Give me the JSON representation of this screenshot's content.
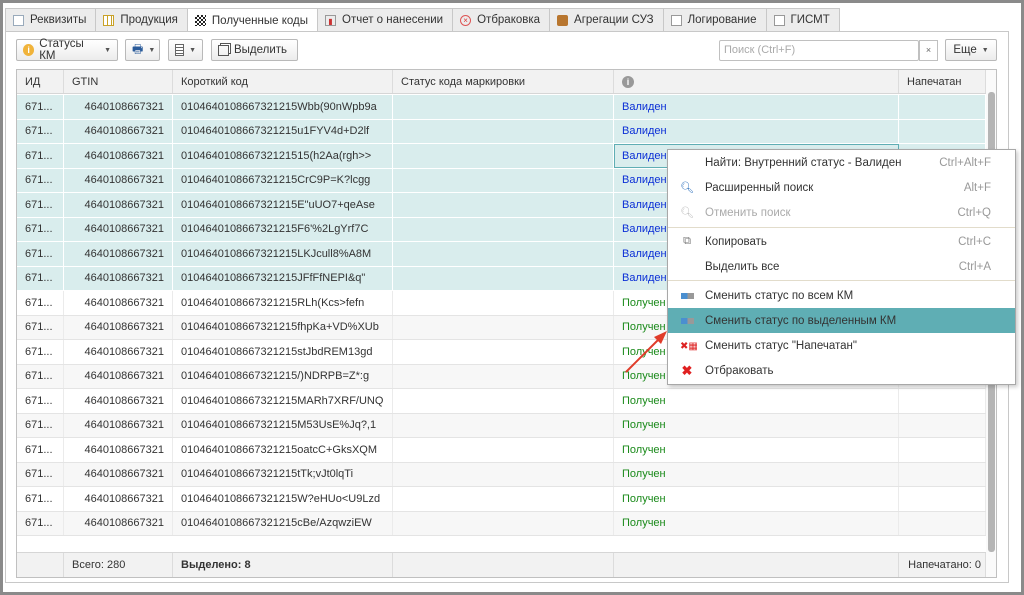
{
  "tabs": [
    {
      "label": "Реквизиты",
      "icon": "document-icon"
    },
    {
      "label": "Продукция",
      "icon": "table-icon"
    },
    {
      "label": "Полученные коды",
      "icon": "qr-code-icon",
      "active": true
    },
    {
      "label": "Отчет о нанесении",
      "icon": "report-icon"
    },
    {
      "label": "Отбраковка",
      "icon": "reject-icon"
    },
    {
      "label": "Агрегации СУЗ",
      "icon": "box-icon"
    },
    {
      "label": "Логирование",
      "icon": "log-icon"
    },
    {
      "label": "ГИСМТ",
      "icon": "gismt-icon"
    }
  ],
  "toolbar": {
    "statuses": "Статусы КМ",
    "select": "Выделить",
    "search_placeholder": "Поиск (Ctrl+F)",
    "more": "Еще"
  },
  "columns": [
    "ИД",
    "GTIN",
    "Короткий код",
    "Статус кода маркировки",
    "",
    "Напечатан"
  ],
  "rows": [
    {
      "id": "671...",
      "gtin": "4640108667321",
      "code": "0104640108667321215Wbb(90nWpb9a",
      "status": "Валиден",
      "sel": true
    },
    {
      "id": "671...",
      "gtin": "4640108667321",
      "code": "0104640108667321215u1FYV4d+D2lf",
      "status": "Валиден",
      "sel": true
    },
    {
      "id": "671...",
      "gtin": "4640108667321",
      "code": "010464010866732121515(h2Aa(rgh>>",
      "status": "Валиден",
      "sel": true
    },
    {
      "id": "671...",
      "gtin": "4640108667321",
      "code": "0104640108667321215CrC9P=K?lcgg",
      "status": "Валиден",
      "sel": true
    },
    {
      "id": "671...",
      "gtin": "4640108667321",
      "code": "0104640108667321215E\"uUO7+qeAse",
      "status": "Валиден",
      "sel": true
    },
    {
      "id": "671...",
      "gtin": "4640108667321",
      "code": "0104640108667321215F6'%2LgYrf7C",
      "status": "Валиден",
      "sel": true
    },
    {
      "id": "671...",
      "gtin": "4640108667321",
      "code": "0104640108667321215LKJcull8%A8M",
      "status": "Валиден",
      "sel": true
    },
    {
      "id": "671...",
      "gtin": "4640108667321",
      "code": "0104640108667321215JFfFfNEPI&q\"",
      "status": "Валиден",
      "sel": true
    },
    {
      "id": "671...",
      "gtin": "4640108667321",
      "code": "0104640108667321215RLh(Kcs>fefn",
      "status": "Получен"
    },
    {
      "id": "671...",
      "gtin": "4640108667321",
      "code": "0104640108667321215fhpKa+VD%XUb",
      "status": "Получен"
    },
    {
      "id": "671...",
      "gtin": "4640108667321",
      "code": "0104640108667321215stJbdREM13gd",
      "status": "Получен"
    },
    {
      "id": "671...",
      "gtin": "4640108667321",
      "code": "0104640108667321215/)NDRPB=Z*:g",
      "status": "Получен"
    },
    {
      "id": "671...",
      "gtin": "4640108667321",
      "code": "0104640108667321215MARh7XRF/UNQ",
      "status": "Получен"
    },
    {
      "id": "671...",
      "gtin": "4640108667321",
      "code": "0104640108667321215M53UsE%Jq?,1",
      "status": "Получен"
    },
    {
      "id": "671...",
      "gtin": "4640108667321",
      "code": "0104640108667321215oatcC+GksXQM",
      "status": "Получен"
    },
    {
      "id": "671...",
      "gtin": "4640108667321",
      "code": "0104640108667321215tTk;vJt0lqTi",
      "status": "Получен"
    },
    {
      "id": "671...",
      "gtin": "4640108667321",
      "code": "0104640108667321215W?eHUo<U9Lzd",
      "status": "Получен"
    },
    {
      "id": "671...",
      "gtin": "4640108667321",
      "code": "0104640108667321215cBe/AzqwziEW",
      "status": "Получен"
    }
  ],
  "footer": {
    "total": "Всего: 280",
    "selected": "Выделено: 8",
    "printed": "Напечатано: 0"
  },
  "menu": [
    {
      "label": "Найти: Внутренний статус - Валиден",
      "shortcut": "Ctrl+Alt+F",
      "icon": ""
    },
    {
      "label": "Расширенный поиск",
      "shortcut": "Alt+F",
      "icon": "search-icon"
    },
    {
      "label": "Отменить поиск",
      "shortcut": "Ctrl+Q",
      "icon": "cancel-search-icon",
      "disabled": true
    },
    {
      "label": "Копировать",
      "shortcut": "Ctrl+C",
      "icon": "copy-icon"
    },
    {
      "label": "Выделить все",
      "shortcut": "Ctrl+A",
      "icon": ""
    },
    {
      "label": "Сменить статус по всем КМ",
      "shortcut": "",
      "icon": "change-status-icon"
    },
    {
      "label": "Сменить статус по выделенным КМ",
      "shortcut": "",
      "icon": "change-status-icon",
      "highlighted": true
    },
    {
      "label": "Сменить статус \"Напечатан\"",
      "shortcut": "",
      "icon": "printed-status-icon"
    },
    {
      "label": "Отбраковать",
      "shortcut": "",
      "icon": "reject-x-icon"
    }
  ],
  "colors": {
    "selected_row": "#d9eded",
    "valid": "#0b2fd6",
    "received": "#1a8a1a",
    "menu_highlight": "#5faeb4",
    "arrow": "#e03c2a"
  }
}
